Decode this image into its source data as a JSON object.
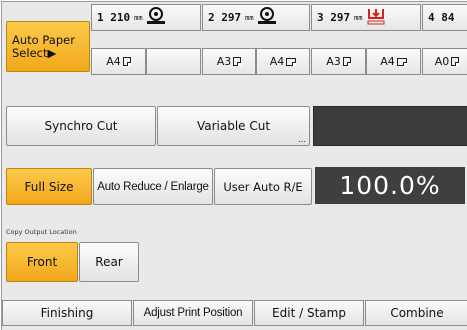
{
  "paper": {
    "auto_select_label_1": "Auto Paper",
    "auto_select_label_2": "Select▶",
    "trays": [
      {
        "length": "1 210",
        "unit": "mm",
        "icon": "roll-feed-icon"
      },
      {
        "length": "2 297",
        "unit": "mm",
        "icon": "roll-feed-icon"
      },
      {
        "length": "3 297",
        "unit": "mm",
        "icon": "roll-alert-icon"
      },
      {
        "length": "4 84",
        "unit": "",
        "icon": ""
      }
    ],
    "sizes": [
      "A4",
      "",
      "A3",
      "A4",
      "A3",
      "A4",
      "A0"
    ]
  },
  "cut": {
    "synchro_label": "Synchro Cut",
    "variable_label": "Variable Cut"
  },
  "reduce": {
    "full_size_label": "Full Size",
    "auto_label": "Auto Reduce / Enlarge",
    "user_label": "User Auto R/E",
    "ratio": "100.0%"
  },
  "output": {
    "section_label": "Copy Output Location",
    "front_label": "Front",
    "rear_label": "Rear"
  },
  "tabs": [
    "Finishing",
    "Adjust Print Position",
    "Edit / Stamp",
    "Combine"
  ],
  "colors": {
    "selected": "#f3a81c",
    "dark_display": "#3c3c3c",
    "alert": "#d42020"
  }
}
